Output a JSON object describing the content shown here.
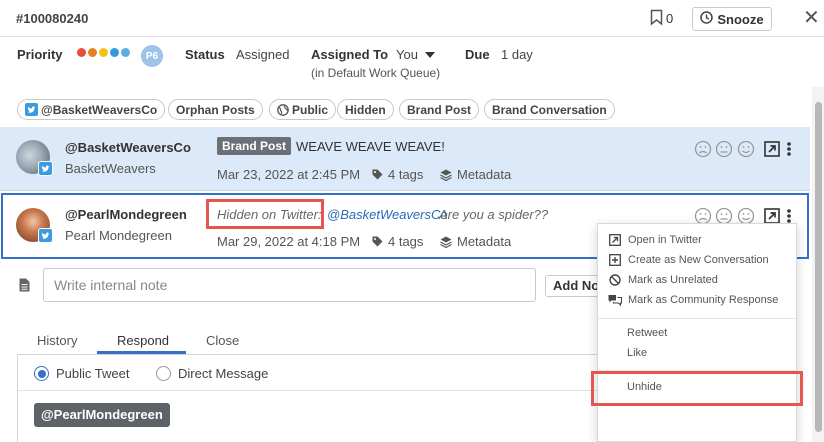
{
  "header": {
    "ticket_id": "#100080240",
    "bookmark_count": "0",
    "snooze_label": "Snooze",
    "close_label": "✕"
  },
  "ticket": {
    "priority_label": "Priority",
    "priority_badge": "P6",
    "priority_colors": [
      "#e74c3c",
      "#e67e22",
      "#f1c40f",
      "#3498db",
      "#5dade2"
    ],
    "status_label": "Status",
    "status_value": "Assigned",
    "assigned_label": "Assigned To",
    "assigned_value": "You",
    "assigned_queue": "(in Default Work Queue)",
    "due_label": "Due",
    "due_value": "1 day"
  },
  "tags": [
    "@BasketWeaversCo",
    "Orphan Posts",
    "Public",
    "Hidden",
    "Brand Post",
    "Brand Conversation"
  ],
  "messages": [
    {
      "handle": "@BasketWeaversCo",
      "display_name": "BasketWeavers",
      "badge": "Brand Post",
      "text": "WEAVE WEAVE WEAVE!",
      "timestamp": "Mar 23, 2022 at 2:45 PM",
      "tags": "4 tags",
      "metadata": "Metadata"
    },
    {
      "handle": "@PearlMondegreen",
      "display_name": "Pearl Mondegreen",
      "hidden_prefix": "Hidden on Twitter:",
      "mention": "@BasketWeaversCo",
      "text": "Are you a spider??",
      "timestamp": "Mar 29, 2022 at 4:18 PM",
      "tags": "4 tags",
      "metadata": "Metadata"
    }
  ],
  "note": {
    "placeholder": "Write internal note",
    "add_button": "Add Note"
  },
  "tabs": [
    "History",
    "Respond",
    "Close"
  ],
  "respond": {
    "option_public": "Public Tweet",
    "option_dm": "Direct Message",
    "mention_chip": "@PearlMondegreen"
  },
  "menu": {
    "items": [
      {
        "label": "Open in Twitter",
        "icon": "open-external-icon"
      },
      {
        "label": "Create as New Conversation",
        "icon": "plus-square-icon"
      },
      {
        "label": "Mark as Unrelated",
        "icon": "ban-icon"
      },
      {
        "label": "Mark as Community Response",
        "icon": "chat-bubbles-icon"
      }
    ],
    "twitter_actions": [
      "Retweet",
      "Like"
    ],
    "unhide": "Unhide"
  }
}
